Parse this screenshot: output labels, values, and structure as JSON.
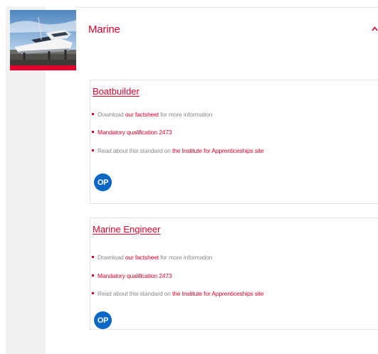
{
  "section": {
    "title": "Marine",
    "colors": {
      "accent": "#e4002b",
      "badge": "#0b67c4",
      "muted_text": "#8a8a8a"
    },
    "icons": {
      "toggle": "chevron-up-icon"
    }
  },
  "cards": [
    {
      "title": "Boatbuilder",
      "download": {
        "prefix": "Download ",
        "link": "our factsheet",
        "suffix": " for more information"
      },
      "qualification": "Mandatory qualification 2473",
      "standard": {
        "prefix": "Read about this standard on ",
        "link": "the Institute for Apprenticeships site"
      },
      "badge": "OP"
    },
    {
      "title": "Marine Engineer",
      "download": {
        "prefix": "Download ",
        "link": "our factsheet",
        "suffix": " for more information"
      },
      "qualification": "Mandatory qualification 2473",
      "standard": {
        "prefix": "Read about this standard on ",
        "link": "the Institute for Apprenticeships site"
      },
      "badge": "OP"
    }
  ]
}
